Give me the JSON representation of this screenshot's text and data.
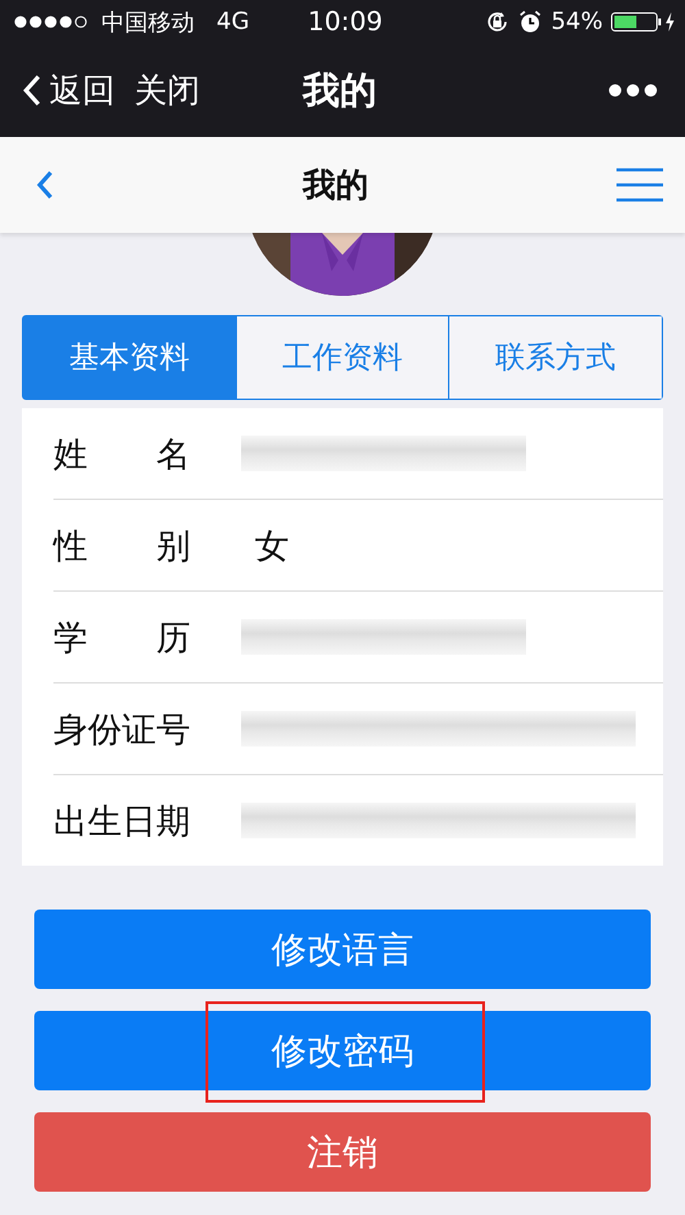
{
  "status_bar": {
    "carrier": "中国移动",
    "network": "4G",
    "time": "10:09",
    "battery": "54%"
  },
  "nav_bar": {
    "back": "返回",
    "close": "关闭",
    "title": "我的"
  },
  "header": {
    "title": "我的"
  },
  "tabs": [
    {
      "label": "基本资料",
      "selected": true
    },
    {
      "label": "工作资料",
      "selected": false
    },
    {
      "label": "联系方式",
      "selected": false
    }
  ],
  "fields": [
    {
      "label": "姓　　名",
      "kind": "blurred"
    },
    {
      "label": "性　　别",
      "kind": "text",
      "value": "女"
    },
    {
      "label": "学　　历",
      "kind": "blurred"
    },
    {
      "label": "身份证号",
      "kind": "blurred-long"
    },
    {
      "label": "出生日期",
      "kind": "blurred-long"
    }
  ],
  "buttons": [
    {
      "label": "修改语言",
      "kind": "primary",
      "highlighted": false
    },
    {
      "label": "修改密码",
      "kind": "primary",
      "highlighted": true
    },
    {
      "label": "注销",
      "kind": "danger",
      "highlighted": false
    }
  ]
}
